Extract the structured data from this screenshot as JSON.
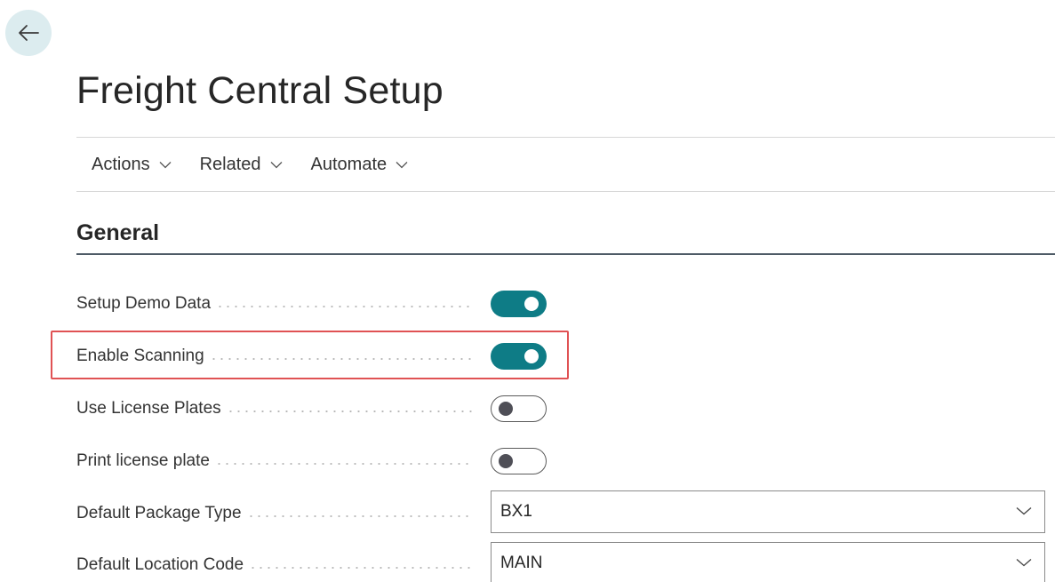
{
  "navigation": {
    "back_icon": "arrow-left-icon"
  },
  "page": {
    "title": "Freight Central Setup"
  },
  "action_bar": {
    "items": [
      {
        "label": "Actions",
        "icon": "chevron-down-icon"
      },
      {
        "label": "Related",
        "icon": "chevron-down-icon"
      },
      {
        "label": "Automate",
        "icon": "chevron-down-icon"
      }
    ]
  },
  "section": {
    "title": "General"
  },
  "fields": [
    {
      "label": "Setup Demo Data",
      "type": "toggle",
      "value": true
    },
    {
      "label": "Enable Scanning",
      "type": "toggle",
      "value": true,
      "highlighted": true
    },
    {
      "label": "Use License Plates",
      "type": "toggle",
      "value": false
    },
    {
      "label": "Print license plate",
      "type": "toggle",
      "value": false
    },
    {
      "label": "Default Package Type",
      "type": "select",
      "value": "BX1"
    },
    {
      "label": "Default Location Code",
      "type": "select",
      "value": "MAIN"
    }
  ],
  "colors": {
    "accent": "#0e7c86",
    "highlight": "#e05254",
    "back_button_bg": "#dcecef",
    "section_rule": "#4e5b66"
  }
}
